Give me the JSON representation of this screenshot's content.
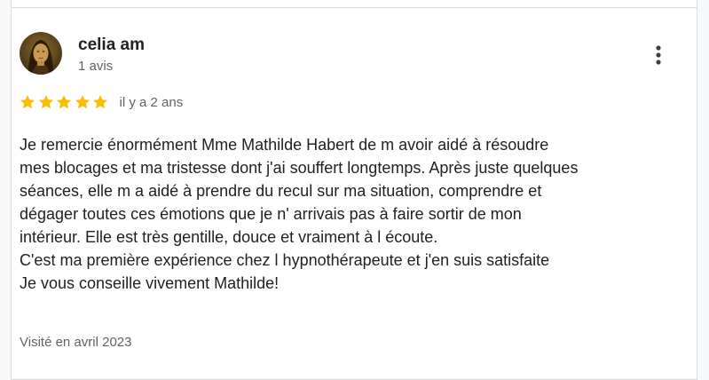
{
  "review": {
    "author": {
      "name": "celia am",
      "review_count": "1 avis",
      "avatar_icon": "mona-lisa-avatar"
    },
    "rating": {
      "stars": 5,
      "max_stars": 5,
      "star_color": "#fbbc04"
    },
    "time_ago": "il y a 2 ans",
    "text_lines": [
      "Je remercie énormément Mme Mathilde Habert de m avoir aidé à résoudre",
      "mes blocages et ma tristesse dont j'ai souffert longtemps. Après juste quelques",
      "séances, elle m a aidé à prendre du recul sur ma situation, comprendre et",
      "dégager toutes ces émotions que je n' arrivais pas à faire sortir de mon",
      "intérieur. Elle est très gentille, douce et vraiment à l écoute.",
      "C'est ma première expérience chez l hypnothérapeute et j'en suis satisfaite",
      "Je vous conseille vivement Mathilde!"
    ],
    "visited": "Visité en avril 2023",
    "more_icon": "more-vert-icon"
  }
}
